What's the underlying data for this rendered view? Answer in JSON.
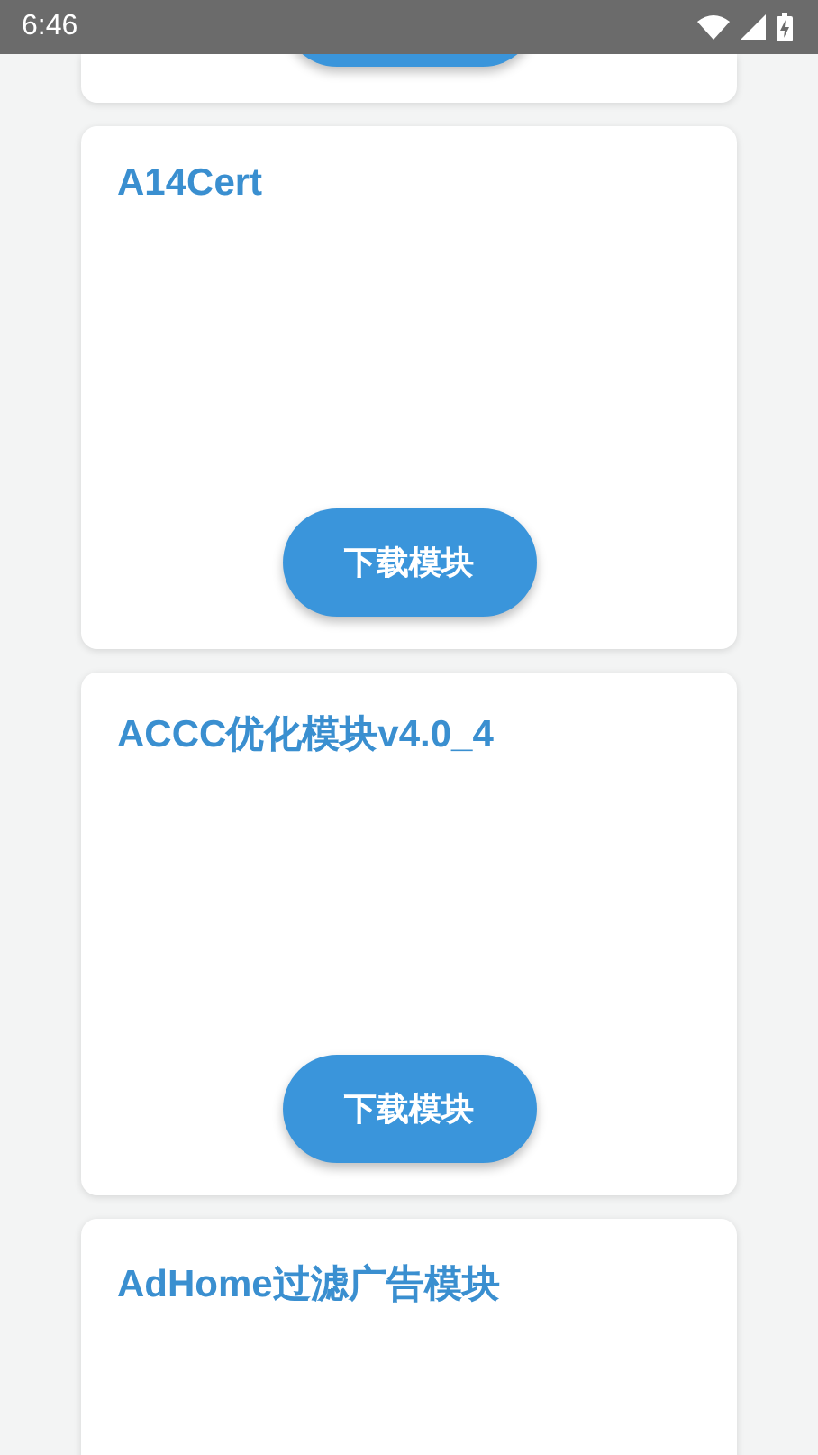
{
  "status_bar": {
    "time": "6:46"
  },
  "cards": [
    {
      "kind": "tail"
    },
    {
      "kind": "full",
      "title": "A14Cert",
      "button": "下载模块"
    },
    {
      "kind": "full",
      "title": "ACCC优化模块v4.0_4",
      "button": "下载模块"
    },
    {
      "kind": "head",
      "title": "AdHome过滤广告模块"
    }
  ]
}
